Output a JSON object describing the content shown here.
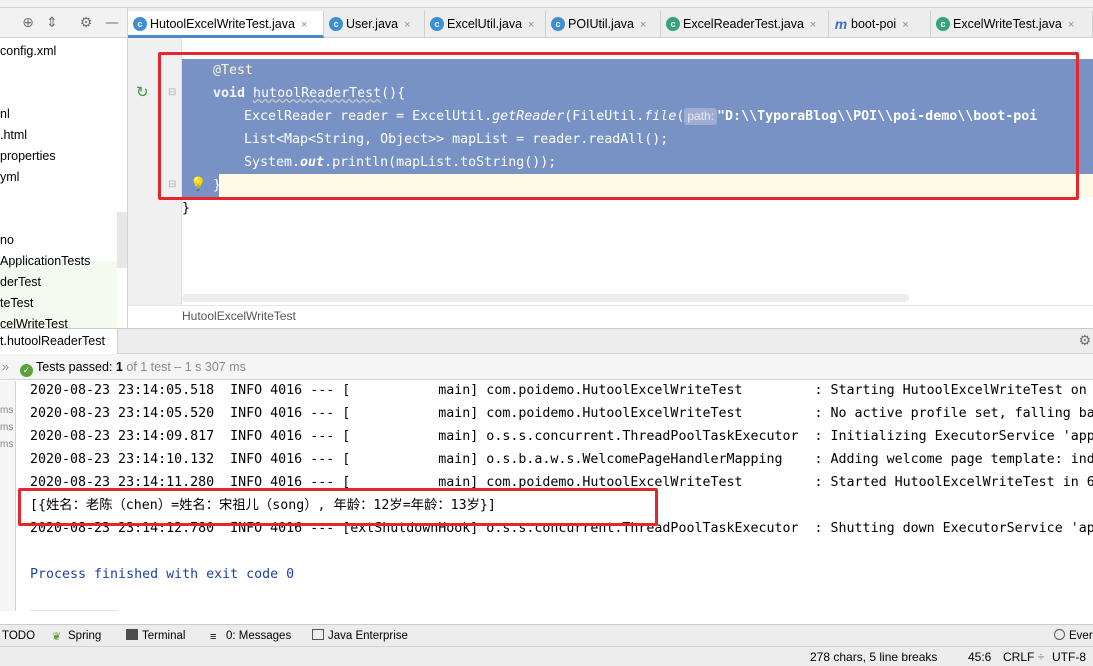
{
  "project_tree": {
    "items": [
      "config.xml",
      "nl",
      ".html",
      "properties",
      "yml",
      "no",
      "ApplicationTests",
      "derTest",
      "teTest",
      "celWriteTest"
    ]
  },
  "editor_tabs": [
    {
      "label": "HutoolExcelWriteTest.java",
      "icon": "c",
      "active": true
    },
    {
      "label": "User.java",
      "icon": "c"
    },
    {
      "label": "ExcelUtil.java",
      "icon": "c"
    },
    {
      "label": "POIUtil.java",
      "icon": "c"
    },
    {
      "label": "ExcelReaderTest.java",
      "icon": "cg"
    },
    {
      "label": "boot-poi",
      "icon": "m"
    },
    {
      "label": "ExcelWriteTest.java",
      "icon": "cg"
    }
  ],
  "code": {
    "annotation": "@Test",
    "kw_void": "void",
    "method_name": "hutoolReaderTest",
    "method_suffix": "(){",
    "line3_a": "ExcelReader reader = ExcelUtil.",
    "line3_m": "getReader",
    "line3_b": "(FileUtil.",
    "line3_m2": "file",
    "line3_c": "(",
    "hint_path": "path:",
    "line3_d": "\"D:\\\\TyporaBlog\\\\POI\\\\poi-demo\\\\boot-poi",
    "line4": "List<Map<String, Object>> mapList = reader.readAll();",
    "line5_a": "System.",
    "line5_out": "out",
    "line5_b": ".println(mapList.toString());",
    "line6": "}",
    "line7": "}"
  },
  "editor_breadcrumb": "HutoolExcelWriteTest",
  "run": {
    "tab_label": "t.hutoolReaderTest",
    "status_passed": "Tests passed:",
    "status_count": "1",
    "status_detail": "of 1 test – 1 s 307 ms",
    "ms_labels": [
      "ms",
      "ms",
      "ms"
    ],
    "log_lines": [
      "2020-08-23 23:14:05.518  INFO 4016 --- [           main] com.poidemo.HutoolExcelWriteTest         : Starting HutoolExcelWriteTest on",
      "2020-08-23 23:14:05.520  INFO 4016 --- [           main] com.poidemo.HutoolExcelWriteTest         : No active profile set, falling ba",
      "2020-08-23 23:14:09.817  INFO 4016 --- [           main] o.s.s.concurrent.ThreadPoolTaskExecutor  : Initializing ExecutorService 'app",
      "2020-08-23 23:14:10.132  INFO 4016 --- [           main] o.s.b.a.w.s.WelcomePageHandlerMapping    : Adding welcome page template: ind",
      "2020-08-23 23:14:11.280  INFO 4016 --- [           main] com.poidemo.HutoolExcelWriteTest         : Started HutoolExcelWriteTest in 6"
    ],
    "result_line": "[{姓名：老陈（chen）=姓名：宋祖儿（song）, 年龄：12岁=年龄：13岁}]",
    "shutdown_line": "2020-08-23 23:14:12.780  INFO 4016 --- [extShutdownHook] o.s.s.concurrent.ThreadPoolTaskExecutor  : Shutting down ExecutorService 'ap",
    "exit_line": "Process finished with exit code 0"
  },
  "bottom_tools": [
    {
      "label": "TODO"
    },
    {
      "label": "Spring"
    },
    {
      "label": "Terminal"
    },
    {
      "label": "0: Messages"
    },
    {
      "label": "Java Enterprise"
    },
    {
      "label": "Ever"
    }
  ],
  "statusbar": {
    "chars": "278 chars, 5 line breaks",
    "position": "45:6",
    "line_sep": "CRLF",
    "encoding": "UTF-8"
  },
  "colors": {
    "selection": "#7892c6",
    "annotation_box": "#e3272d",
    "passed_green": "#5aa33b"
  }
}
